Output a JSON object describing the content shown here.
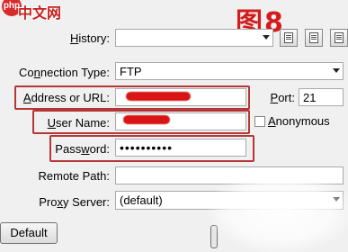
{
  "watermark": {
    "logo": "php",
    "text": "中文网",
    "figure_label": "图8"
  },
  "history": {
    "label": "History:",
    "accesskey": "H",
    "value": ""
  },
  "toolbar_icons": [
    "document-icon",
    "document-list-icon",
    "document-edit-icon"
  ],
  "connection_type": {
    "label": "Connection Type:",
    "accesskey": "n",
    "value": "FTP"
  },
  "address": {
    "label": "Address or URL:",
    "accesskey": "A",
    "value": ""
  },
  "port": {
    "label": "Port:",
    "accesskey": "P",
    "value": "21"
  },
  "user_name": {
    "label": "User Name:",
    "accesskey": "U",
    "value": ""
  },
  "anonymous": {
    "label": "Anonymous",
    "accesskey": "A",
    "checked": false
  },
  "password": {
    "label": "Password:",
    "accesskey": "w",
    "value": "••••••••••"
  },
  "remote_path": {
    "label": "Remote Path:",
    "value": ""
  },
  "proxy_server": {
    "label": "Proxy Server:",
    "accesskey": "x",
    "value": "(default)"
  },
  "buttons": {
    "default": "Default"
  },
  "colors": {
    "highlight_box": "#b33737",
    "redaction": "#d81414"
  }
}
